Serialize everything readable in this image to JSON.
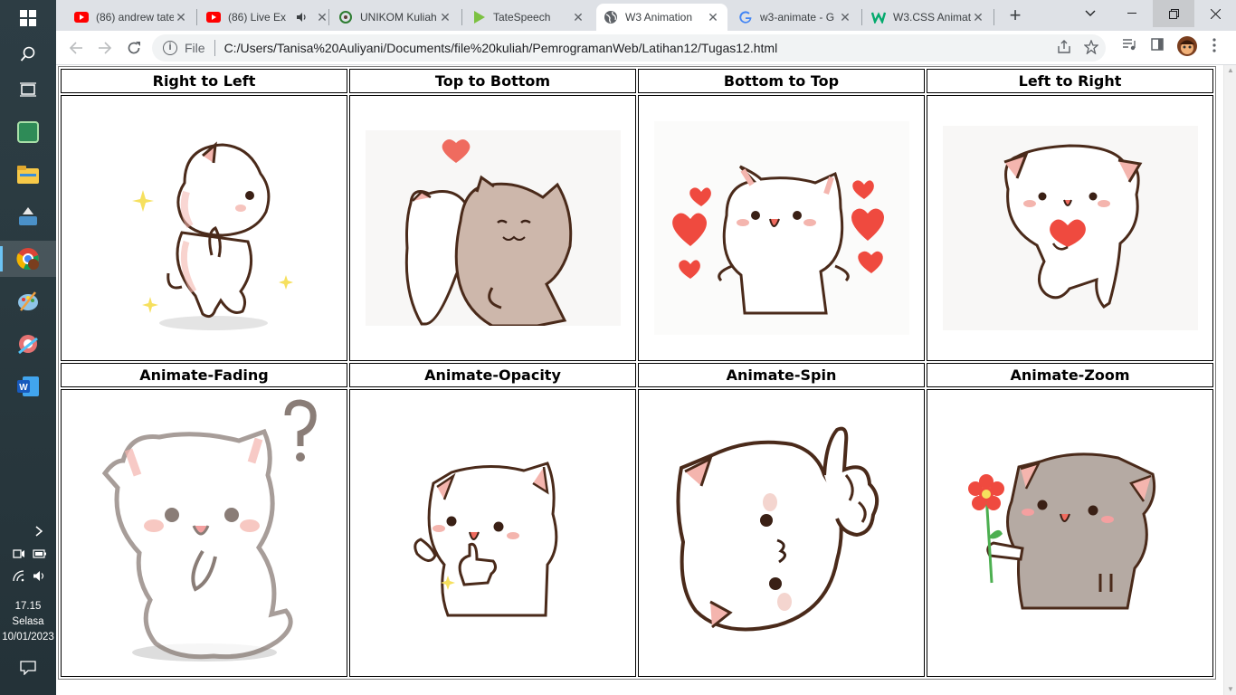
{
  "taskbar": {
    "icons": [
      "windows-start-icon",
      "search-icon",
      "task-view-icon",
      "spreadsheet-app-icon",
      "file-explorer-icon",
      "installer-app-icon",
      "chrome-icon",
      "paint-app-icon",
      "snipping-app-icon",
      "word-icon"
    ],
    "clock": {
      "time": "17.15",
      "day": "Selasa",
      "date": "10/01/2023"
    }
  },
  "browser": {
    "tabs": [
      {
        "label": "(86) andrew tate",
        "icon": "youtube-icon",
        "active": false
      },
      {
        "label": "(86) Live Ex",
        "icon": "youtube-icon",
        "active": false,
        "audio": true
      },
      {
        "label": "UNIKOM Kuliah",
        "icon": "unikom-icon",
        "active": false
      },
      {
        "label": "TateSpeech",
        "icon": "play-icon",
        "active": false
      },
      {
        "label": "W3 Animation",
        "icon": "globe-icon",
        "active": true
      },
      {
        "label": "w3-animate - G",
        "icon": "google-icon",
        "active": false
      },
      {
        "label": "W3.CSS Animat",
        "icon": "w3-icon",
        "active": false
      }
    ],
    "omnibox": {
      "scheme_label": "File",
      "url": "C:/Users/Tanisa%20Auliyani/Documents/file%20kuliah/PemrogramanWeb/Latihan12/Tugas12.html"
    }
  },
  "page": {
    "headers_row1": [
      "Right to Left",
      "Top to Bottom",
      "Bottom to Top",
      "Left to Right"
    ],
    "headers_row2": [
      "Animate-Fading",
      "Animate-Opacity",
      "Animate-Spin",
      "Animate-Zoom"
    ]
  },
  "colors": {
    "taskbar": "#2d3d44",
    "tabstrip": "#dee1e6",
    "cat_outline": "#4a2a1a",
    "cat_pink": "#f4b5ae",
    "heart": "#ef4a3f",
    "brown_cat": "#cdb7ab",
    "gray_cat": "#b5aaa3"
  }
}
